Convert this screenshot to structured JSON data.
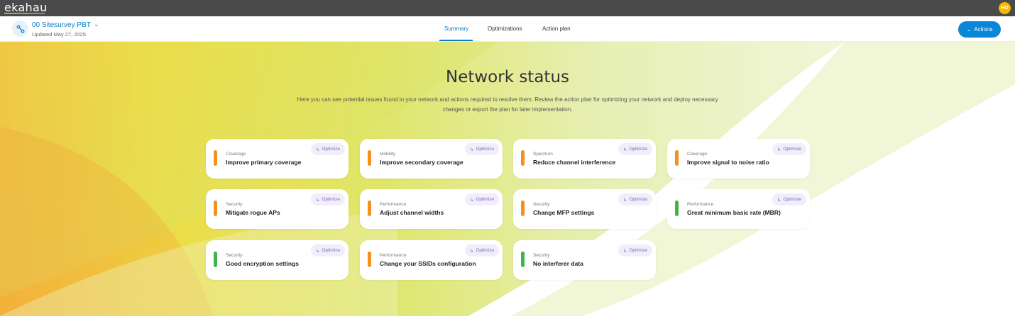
{
  "app": {
    "logo": "ekahau",
    "user_initials": "HO"
  },
  "project": {
    "name": "00 Sitesurvey PBT",
    "updated": "Updated May 27, 2025"
  },
  "tabs": [
    {
      "label": "Summary",
      "active": true
    },
    {
      "label": "Optimizations",
      "active": false
    },
    {
      "label": "Action plan",
      "active": false
    }
  ],
  "actions_label": "Actions",
  "main": {
    "title": "Network status",
    "subtitle_line1": "Here you can see potential issues found in your network and actions required to resolve them. Review the action plan for optimizing your network and deploy necessary",
    "subtitle_line2": "changes or export the plan for later implementation."
  },
  "optimize_label": "Optimize",
  "cards": [
    {
      "category": "Coverage",
      "name": "Improve primary coverage",
      "status": "orange"
    },
    {
      "category": "Mobility",
      "name": "Improve secondary coverage",
      "status": "orange"
    },
    {
      "category": "Spectrum",
      "name": "Reduce channel interference",
      "status": "orange"
    },
    {
      "category": "Coverage",
      "name": "Improve signal to noise ratio",
      "status": "orange"
    },
    {
      "category": "Security",
      "name": "Mitigate rogue APs",
      "status": "orange"
    },
    {
      "category": "Performance",
      "name": "Adjust channel widths",
      "status": "orange"
    },
    {
      "category": "Security",
      "name": "Change MFP settings",
      "status": "orange"
    },
    {
      "category": "Performance",
      "name": "Great minimum basic rate (MBR)",
      "status": "green"
    },
    {
      "category": "Security",
      "name": "Good encryption settings",
      "status": "green"
    },
    {
      "category": "Performance",
      "name": "Change your SSIDs configuration",
      "status": "orange"
    },
    {
      "category": "Security",
      "name": "No interferer data",
      "status": "green"
    }
  ],
  "colors": {
    "accent": "#0a86d8",
    "warning": "#f5901e",
    "ok": "#3db54a",
    "optimize_text": "#7b61c8"
  }
}
